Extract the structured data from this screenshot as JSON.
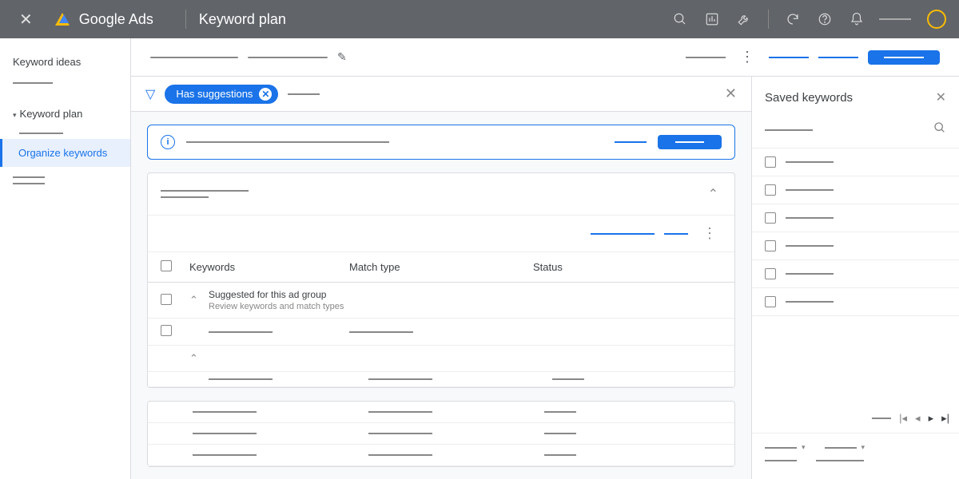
{
  "header": {
    "brand": "Google Ads",
    "page_title": "Keyword plan"
  },
  "sidebar": {
    "item_ideas": "Keyword ideas",
    "item_plan": "Keyword plan",
    "item_organize": "Organize keywords"
  },
  "filter": {
    "chip_label": "Has suggestions"
  },
  "table": {
    "col_keywords": "Keywords",
    "col_match": "Match type",
    "col_status": "Status",
    "suggested_title": "Suggested for this ad group",
    "suggested_sub": "Review keywords and match types"
  },
  "panel": {
    "title": "Saved keywords"
  }
}
